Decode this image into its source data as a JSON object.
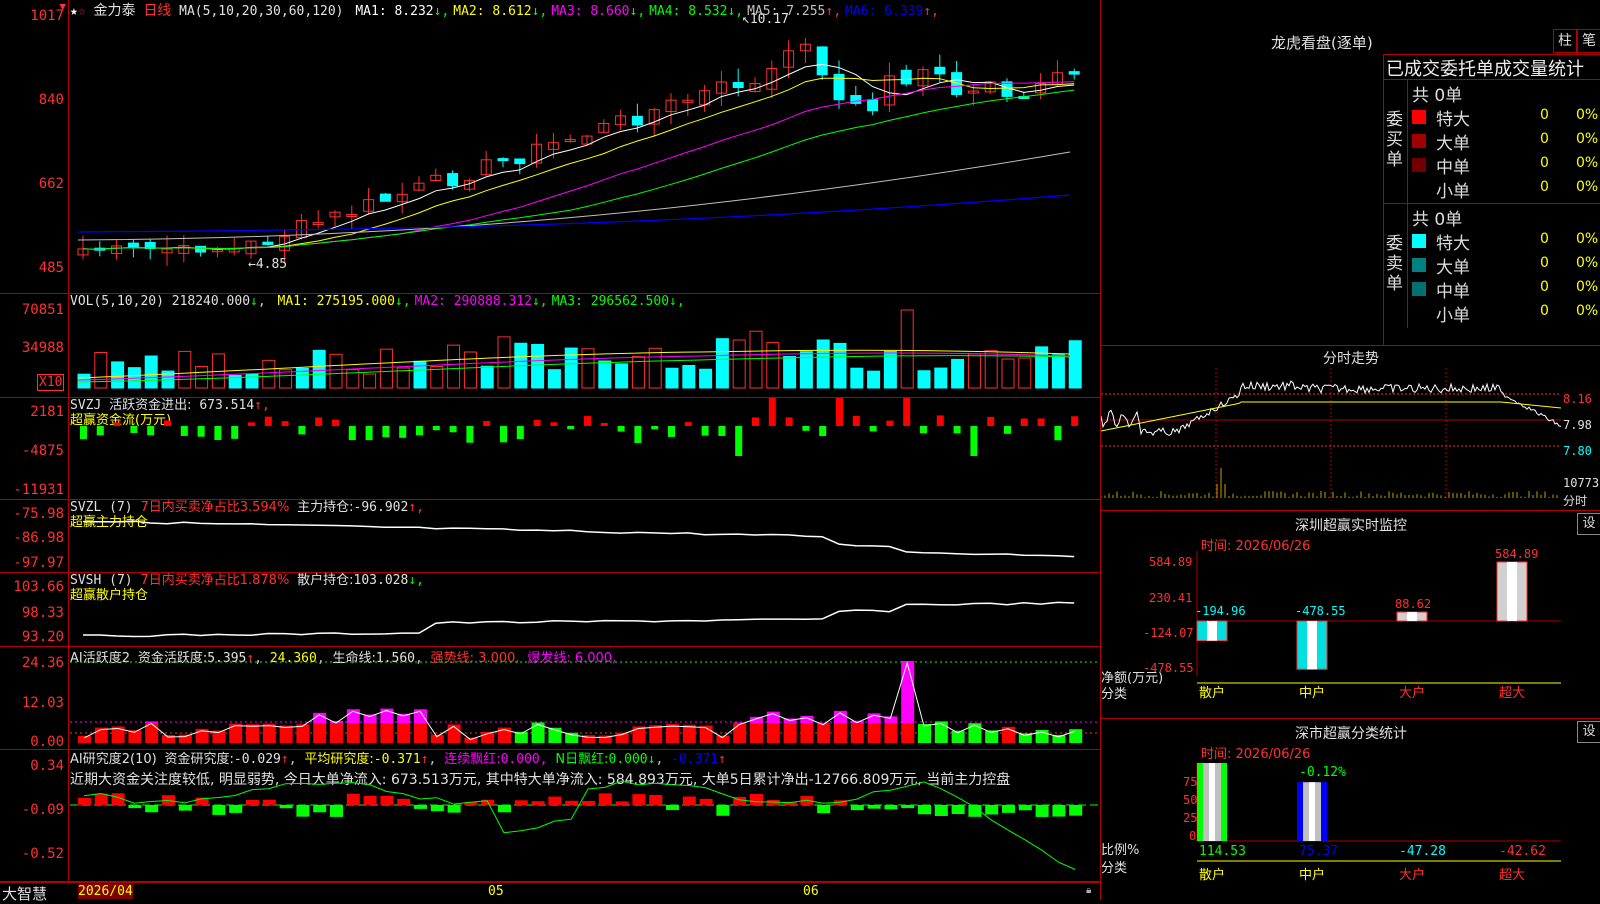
{
  "main": {
    "stock_name": "金力泰",
    "period": "日线",
    "ma_params": "MA(5,10,20,30,60,120)",
    "ma_values": [
      {
        "name": "MA1",
        "value": "8.232",
        "dir": "↓",
        "color": "#ffffff"
      },
      {
        "name": "MA2",
        "value": "8.612",
        "dir": "↓",
        "color": "#ffff00"
      },
      {
        "name": "MA3",
        "value": "8.660",
        "dir": "↓",
        "color": "#ff00ff"
      },
      {
        "name": "MA4",
        "value": "8.532",
        "dir": "↓",
        "color": "#00ff00"
      },
      {
        "name": "MA5",
        "value": "7.255",
        "dir": "↑",
        "color": "#c0c0c0"
      },
      {
        "name": "MA6",
        "value": "6.339",
        "dir": "↑",
        "color": "#0000ff"
      }
    ],
    "y_labels": [
      "1017",
      "840",
      "662",
      "485"
    ],
    "high_label": "10.17",
    "low_label": "4.85"
  },
  "vol": {
    "title": "VOL(5,10,20)",
    "value": "218240.000",
    "ma": [
      {
        "name": "MA1",
        "value": "275195.000",
        "dir": "↓",
        "color": "#ffff00"
      },
      {
        "name": "MA2",
        "value": "290888.312",
        "dir": "↓",
        "color": "#ff00ff"
      },
      {
        "name": "MA3",
        "value": "296562.500",
        "dir": "↓",
        "color": "#00ff00"
      }
    ],
    "y_labels": [
      "70851",
      "34988"
    ],
    "unit": "X10"
  },
  "svzj": {
    "title": "SVZJ",
    "line1_label": "活跃资金进出:",
    "line1_value": "673.514",
    "line1_dir": "↑,",
    "line2": "超赢资金流(万元)",
    "y_labels": [
      "2181",
      "-4875",
      "-11931"
    ]
  },
  "svzl": {
    "title": "SVZL (7)",
    "pct_label": "7日内买卖净占比3.594%",
    "hold_label": "主力持仓:",
    "hold_value": "-96.902",
    "hold_dir": "↑,",
    "line2": "超赢主力持仓",
    "y_labels": [
      "-75.98",
      "-86.98",
      "-97.97"
    ]
  },
  "svsh": {
    "title": "SVSH (7)",
    "pct_label": "7日内买卖净占比1.878%",
    "hold_label": "散户持仓:",
    "hold_value": "103.028",
    "hold_dir": "↓,",
    "line2": "超赢散户持仓",
    "y_labels": [
      "103.66",
      "98.33",
      "93.20"
    ]
  },
  "ai_active": {
    "title": "AI活跃度2",
    "label1": "资金活跃度:",
    "value1": "5.395",
    "value2": "24.360",
    "label3": "生命线:",
    "value3": "1.560",
    "strong": "强势线: 3.000,",
    "burst": "爆发线: 6.000,",
    "y_labels": [
      "24.36",
      "12.03",
      "0.00"
    ]
  },
  "ai_research": {
    "title": "AI研究度2(10)",
    "label1": "资金研究度:",
    "value1": "-0.029",
    "label2": "平均研究度:",
    "value2": "-0.371",
    "label3": "连续飘红:",
    "value3": "0.000,",
    "label4": "N日飘红:",
    "value4": "0.000",
    "value5": "-0.371",
    "note": "近期大资金关注度较低, 明显弱势, 今日大单净流入: 673.513万元, 其中特大单净流入: 584.893万元, 大单5日累计净出-12766.809万元, 当前主力控盘",
    "y_labels": [
      "0.34",
      "-0.09",
      "-0.52"
    ]
  },
  "footer": {
    "brand": "大智慧",
    "date": "2026/04",
    "month1": "05",
    "month2": "06"
  },
  "dragon": {
    "title": "龙虎看盘(逐单)",
    "btn1": "柱",
    "btn2": "笔",
    "header": "已成交委托单成交量统计",
    "buy_label": "委买单",
    "sell_label": "委卖单",
    "buy_total": "共 0单",
    "sell_total": "共 0单",
    "buy_rows": [
      {
        "label": "特大",
        "count": "0",
        "pct": "0%",
        "color": "#ff0000"
      },
      {
        "label": "大单",
        "count": "0",
        "pct": "0%",
        "color": "#a00000"
      },
      {
        "label": "中单",
        "count": "0",
        "pct": "0%",
        "color": "#700000"
      },
      {
        "label": "小单",
        "count": "0",
        "pct": "0%",
        "color": ""
      }
    ],
    "sell_rows": [
      {
        "label": "特大",
        "count": "0",
        "pct": "0%",
        "color": "#00ffff"
      },
      {
        "label": "大单",
        "count": "0",
        "pct": "0%",
        "color": "#008080"
      },
      {
        "label": "中单",
        "count": "0",
        "pct": "0%",
        "color": "#007070"
      },
      {
        "label": "小单",
        "count": "0",
        "pct": "0%",
        "color": ""
      }
    ]
  },
  "intraday": {
    "title": "分时走势",
    "y_labels": [
      "8.16",
      "7.98",
      "7.80"
    ],
    "vol_label": "10773",
    "vol_suffix": "分时"
  },
  "monitor": {
    "title": "深圳超赢实时监控",
    "set": "设",
    "time": "时间: 2026/06/26",
    "y_labels": [
      "584.89",
      "230.41",
      "-124.07",
      "-478.55"
    ],
    "net_label": "净额(万元)",
    "cat_label": "分类",
    "bars": [
      {
        "cat": "散户",
        "value": "-194.96"
      },
      {
        "cat": "中户",
        "value": "-478.55"
      },
      {
        "cat": "大户",
        "value": "88.62"
      },
      {
        "cat": "超大",
        "value": "584.89"
      }
    ]
  },
  "classify": {
    "title": "深市超赢分类统计",
    "set": "设",
    "time": "时间: 2026/06/26",
    "y_labels": [
      "75",
      "50",
      "25",
      "0"
    ],
    "ratio_label": "比例%",
    "cat_label": "分类",
    "top_value": "-0.12%",
    "bars": [
      {
        "cat": "散户",
        "value": "114.53"
      },
      {
        "cat": "中户",
        "value": "75.37"
      },
      {
        "cat": "大户",
        "value": "-47.28"
      },
      {
        "cat": "超大",
        "value": "-42.62"
      }
    ]
  }
}
